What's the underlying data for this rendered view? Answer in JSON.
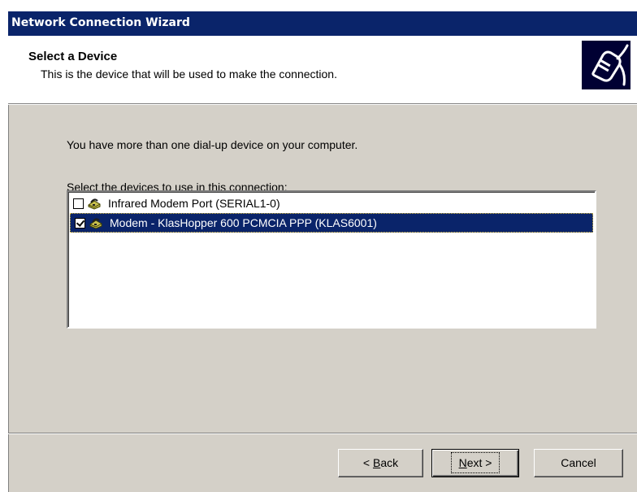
{
  "window": {
    "title": "Network Connection Wizard"
  },
  "header": {
    "title": "Select a Device",
    "subtitle": "This is the device that will be used to make the connection.",
    "icon": "network-plug-icon"
  },
  "body": {
    "intro_text": "You have more than one dial-up device on your computer.",
    "list_label_prefix": "S",
    "list_label_rest": "elect the devices to use in this connection:"
  },
  "devices": [
    {
      "label": "Infrared Modem Port (SERIAL1-0)",
      "checked": false,
      "selected": false,
      "icon": "modem-icon"
    },
    {
      "label": "Modem - KlasHopper 600 PCMCIA PPP (KLAS6001)",
      "checked": true,
      "selected": true,
      "icon": "modem-icon"
    }
  ],
  "buttons": {
    "back_prefix": "< ",
    "back_ul": "B",
    "back_rest": "ack",
    "next_ul": "N",
    "next_rest": "ext >",
    "cancel": "Cancel"
  },
  "colors": {
    "titlebar": "#0a246a",
    "selection": "#0a246a",
    "dialog_face": "#d4d0c8"
  }
}
